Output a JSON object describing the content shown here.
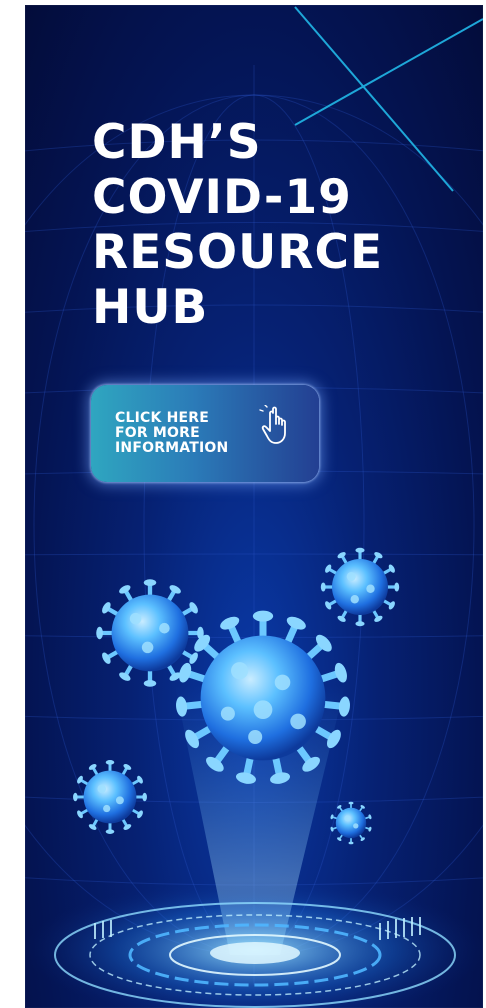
{
  "banner": {
    "title_lines": [
      "CDH’S",
      "COVID-19",
      "RESOURCE",
      "HUB"
    ],
    "cta": {
      "lines": [
        "CLICK HERE",
        "FOR MORE",
        "INFORMATION"
      ],
      "icon": "pointing-hand-icon"
    },
    "illustration": "coronavirus-particles-hologram",
    "colors": {
      "background": "#041453",
      "accent_line": "#1ea7d8",
      "virus": "#3fa8ff",
      "button_start": "#2fa6c0",
      "button_end": "#233f92"
    }
  }
}
